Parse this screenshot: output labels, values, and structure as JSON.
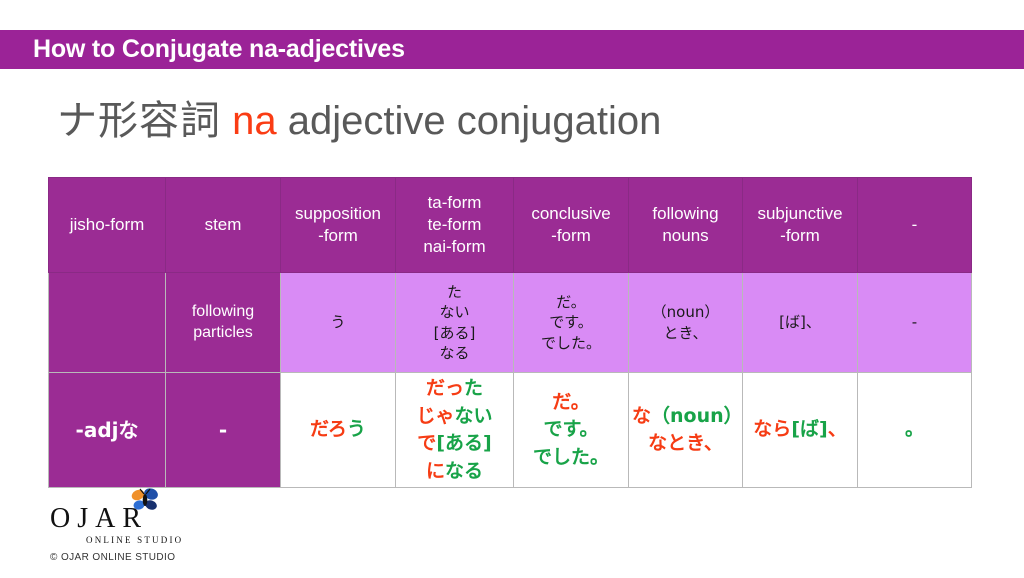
{
  "banner": {
    "title": "How to Conjugate na-adjectives",
    "bg_color": "#9B2397"
  },
  "title": {
    "japanese": "ナ形容詞",
    "accent": "na",
    "rest": " adjective conjugation",
    "accent_color": "#FA3C14",
    "text_color": "#595959"
  },
  "table": {
    "header_bg": "#9B2C94",
    "mid_row_bg": "#D98BF5",
    "red": "#F63C14",
    "green": "#18A348",
    "headers": [
      {
        "lines": [
          "jisho-form"
        ]
      },
      {
        "lines": [
          "stem"
        ]
      },
      {
        "lines": [
          "supposition",
          "-form"
        ]
      },
      {
        "lines": [
          "ta-form",
          "te-form",
          "nai-form"
        ]
      },
      {
        "lines": [
          "conclusive",
          "-form"
        ]
      },
      {
        "lines": [
          "following",
          "nouns"
        ]
      },
      {
        "lines": [
          "subjunctive",
          "-form"
        ]
      },
      {
        "lines": [
          "-"
        ]
      }
    ],
    "row_mid": [
      {
        "type": "header",
        "lines": []
      },
      {
        "type": "header",
        "lines": [
          "following",
          "particles"
        ]
      },
      {
        "type": "plain",
        "lines": [
          "う"
        ]
      },
      {
        "type": "plain",
        "lines": [
          "た",
          "ない",
          "[ある]",
          "なる"
        ]
      },
      {
        "type": "plain",
        "lines": [
          "だ。",
          "です。",
          "でした。"
        ]
      },
      {
        "type": "plain",
        "lines": [
          "（noun）",
          "とき、"
        ]
      },
      {
        "type": "plain",
        "lines": [
          "[ば]、"
        ]
      },
      {
        "type": "plain",
        "lines": [
          "-"
        ]
      }
    ],
    "row_bottom": [
      {
        "type": "header",
        "lines": [
          "-adjな"
        ]
      },
      {
        "type": "header",
        "lines": [
          "-"
        ]
      },
      {
        "type": "colored",
        "lines": [
          [
            {
              "t": "だろ",
              "c": "red"
            },
            {
              "t": "う",
              "c": "green"
            }
          ]
        ]
      },
      {
        "type": "colored",
        "lines": [
          [
            {
              "t": "だっ",
              "c": "red"
            },
            {
              "t": "た",
              "c": "green"
            }
          ],
          [
            {
              "t": "じゃ",
              "c": "red"
            },
            {
              "t": "ない",
              "c": "green"
            }
          ],
          [
            {
              "t": "で",
              "c": "red"
            },
            {
              "t": "[ある]",
              "c": "green"
            }
          ],
          [
            {
              "t": "に",
              "c": "red"
            },
            {
              "t": "なる",
              "c": "green"
            }
          ]
        ]
      },
      {
        "type": "colored",
        "lines": [
          [
            {
              "t": "だ。",
              "c": "red"
            }
          ],
          [
            {
              "t": "です。",
              "c": "green"
            }
          ],
          [
            {
              "t": "でした。",
              "c": "green"
            }
          ]
        ]
      },
      {
        "type": "colored",
        "lines": [
          [
            {
              "t": "な",
              "c": "red"
            },
            {
              "t": "（noun）",
              "c": "green"
            }
          ],
          [
            {
              "t": "な",
              "c": "red"
            },
            {
              "t": "とき、",
              "c": "red"
            }
          ]
        ]
      },
      {
        "type": "colored",
        "lines": [
          [
            {
              "t": "なら",
              "c": "red"
            },
            {
              "t": "[ば]",
              "c": "green"
            },
            {
              "t": "、",
              "c": "red"
            }
          ]
        ]
      },
      {
        "type": "colored",
        "lines": [
          [
            {
              "t": "。",
              "c": "green"
            }
          ]
        ]
      }
    ]
  },
  "logo": {
    "word": "OJAR",
    "sub": "ONLINE STUDIO",
    "copyright": "© OJAR ONLINE STUDIO"
  }
}
